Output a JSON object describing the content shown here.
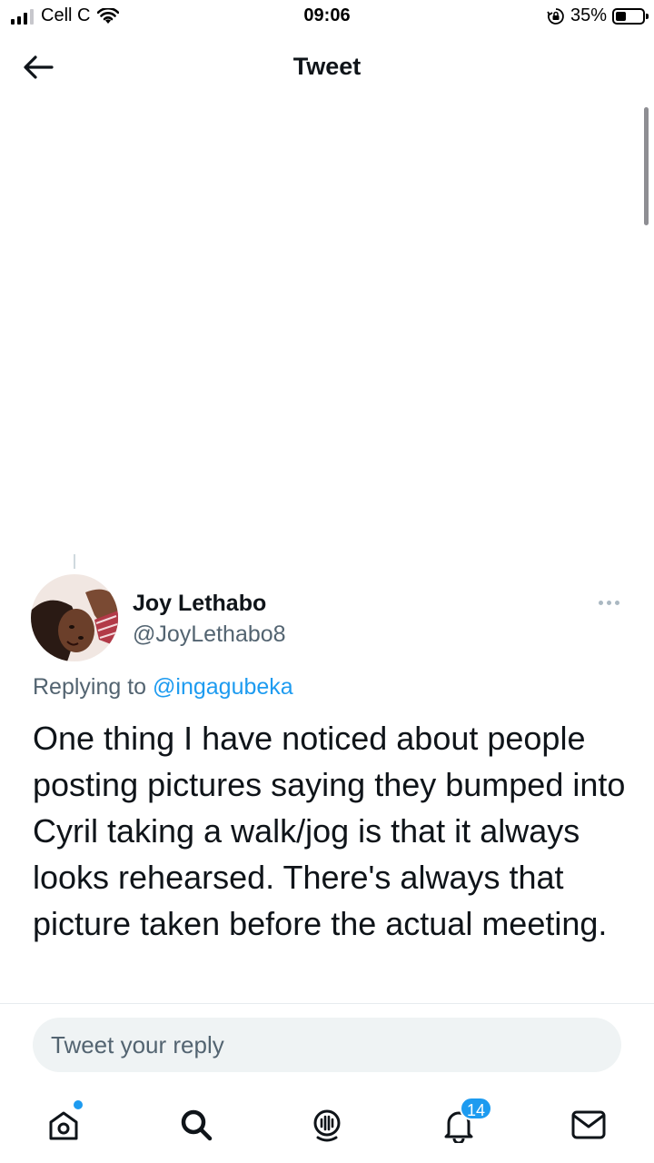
{
  "status_bar": {
    "carrier": "Cell C",
    "time": "09:06",
    "battery_percent": "35%"
  },
  "header": {
    "title": "Tweet",
    "back_icon": "arrow-left-icon"
  },
  "tweet": {
    "author_name": "Joy Lethabo",
    "author_handle": "@JoyLethabo8",
    "replying_to_prefix": "Replying to ",
    "replying_to_handle": "@ingagubeka",
    "text": "One thing I have noticed about people posting pictures saying they bumped into Cyril taking a walk/jog is that it always looks rehearsed. There's always that picture taken before the actual meeting."
  },
  "reply_box": {
    "placeholder": "Tweet your reply"
  },
  "bottom_nav": {
    "items": [
      {
        "name": "home",
        "icon": "home-icon",
        "has_dot": true
      },
      {
        "name": "search",
        "icon": "search-icon"
      },
      {
        "name": "spaces",
        "icon": "spaces-icon"
      },
      {
        "name": "notifications",
        "icon": "bell-icon",
        "badge": "14"
      },
      {
        "name": "messages",
        "icon": "mail-icon"
      }
    ]
  },
  "colors": {
    "accent": "#1d9bf0",
    "text": "#0f1419",
    "secondary_text": "#536471",
    "reply_box_bg": "#eff3f4"
  }
}
